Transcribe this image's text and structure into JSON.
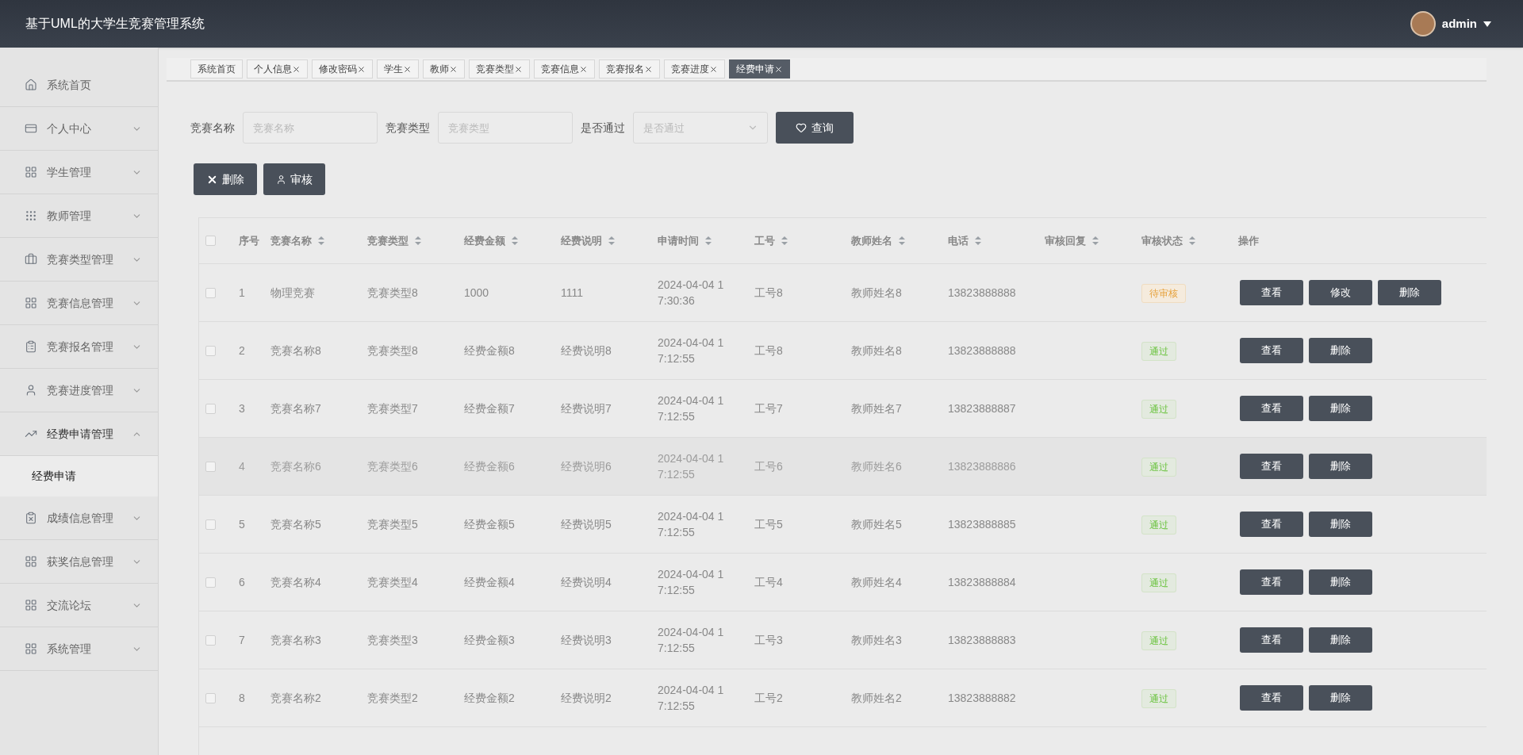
{
  "header": {
    "title": "基于UML的大学生竞赛管理系统",
    "user": "admin"
  },
  "sidebar": {
    "items": [
      {
        "label": "系统首页",
        "kind": "link"
      },
      {
        "label": "个人中心",
        "kind": "menu",
        "expanded": false
      },
      {
        "label": "学生管理",
        "kind": "menu",
        "expanded": false
      },
      {
        "label": "教师管理",
        "kind": "menu",
        "expanded": false
      },
      {
        "label": "竞赛类型管理",
        "kind": "menu",
        "expanded": false
      },
      {
        "label": "竞赛信息管理",
        "kind": "menu",
        "expanded": false
      },
      {
        "label": "竞赛报名管理",
        "kind": "menu",
        "expanded": false
      },
      {
        "label": "竞赛进度管理",
        "kind": "menu",
        "expanded": false
      },
      {
        "label": "经费申请管理",
        "kind": "menu",
        "expanded": true,
        "children": [
          {
            "label": "经费申请",
            "selected": true
          }
        ]
      },
      {
        "label": "成绩信息管理",
        "kind": "menu",
        "expanded": false
      },
      {
        "label": "获奖信息管理",
        "kind": "menu",
        "expanded": false
      },
      {
        "label": "交流论坛",
        "kind": "menu",
        "expanded": false
      },
      {
        "label": "系统管理",
        "kind": "menu",
        "expanded": false
      }
    ]
  },
  "tabs": [
    {
      "label": "系统首页",
      "closable": false,
      "selected": false
    },
    {
      "label": "个人信息",
      "closable": true,
      "selected": false
    },
    {
      "label": "修改密码",
      "closable": true,
      "selected": false
    },
    {
      "label": "学生",
      "closable": true,
      "selected": false
    },
    {
      "label": "教师",
      "closable": true,
      "selected": false
    },
    {
      "label": "竞赛类型",
      "closable": true,
      "selected": false
    },
    {
      "label": "竞赛信息",
      "closable": true,
      "selected": false
    },
    {
      "label": "竞赛报名",
      "closable": true,
      "selected": false
    },
    {
      "label": "竞赛进度",
      "closable": true,
      "selected": false
    },
    {
      "label": "经费申请",
      "closable": true,
      "selected": true
    }
  ],
  "filters": [
    {
      "label": "竞赛名称",
      "placeholder": "竞赛名称",
      "kind": "text"
    },
    {
      "label": "竞赛类型",
      "placeholder": "竞赛类型",
      "kind": "text"
    },
    {
      "label": "是否通过",
      "placeholder": "是否通过",
      "kind": "select"
    }
  ],
  "search_button": "查询",
  "actions": [
    {
      "label": "删除",
      "kind": "delete"
    },
    {
      "label": "审核",
      "kind": "review"
    }
  ],
  "table": {
    "all_checked": false,
    "columns": [
      "序号",
      "竞赛名称",
      "竞赛类型",
      "经费金额",
      "经费说明",
      "申请时间",
      "工号",
      "教师姓名",
      "电话",
      "审核回复",
      "审核状态",
      "操作"
    ],
    "rows": [
      {
        "checked": false,
        "hovered": false,
        "cells": [
          "1",
          "物理竞赛",
          "竞赛类型8",
          "1000",
          "1111",
          "2024-04-04 17:30:36",
          "工号8",
          "教师姓名8",
          "13823888888",
          ""
        ],
        "status": {
          "text": "待审核",
          "kind": "pending"
        },
        "buttons": [
          "查看",
          "修改",
          "删除"
        ]
      },
      {
        "checked": false,
        "hovered": false,
        "cells": [
          "2",
          "竞赛名称8",
          "竞赛类型8",
          "经费金额8",
          "经费说明8",
          "2024-04-04 17:12:55",
          "工号8",
          "教师姓名8",
          "13823888888",
          ""
        ],
        "status": {
          "text": "通过",
          "kind": "passed"
        },
        "buttons": [
          "查看",
          "删除"
        ]
      },
      {
        "checked": false,
        "hovered": false,
        "cells": [
          "3",
          "竞赛名称7",
          "竞赛类型7",
          "经费金额7",
          "经费说明7",
          "2024-04-04 17:12:55",
          "工号7",
          "教师姓名7",
          "13823888887",
          ""
        ],
        "status": {
          "text": "通过",
          "kind": "passed"
        },
        "buttons": [
          "查看",
          "删除"
        ]
      },
      {
        "checked": false,
        "hovered": true,
        "cells": [
          "4",
          "竞赛名称6",
          "竞赛类型6",
          "经费金额6",
          "经费说明6",
          "2024-04-04 17:12:55",
          "工号6",
          "教师姓名6",
          "13823888886",
          ""
        ],
        "status": {
          "text": "通过",
          "kind": "passed"
        },
        "buttons": [
          "查看",
          "删除"
        ]
      },
      {
        "checked": false,
        "hovered": false,
        "cells": [
          "5",
          "竞赛名称5",
          "竞赛类型5",
          "经费金额5",
          "经费说明5",
          "2024-04-04 17:12:55",
          "工号5",
          "教师姓名5",
          "13823888885",
          ""
        ],
        "status": {
          "text": "通过",
          "kind": "passed"
        },
        "buttons": [
          "查看",
          "删除"
        ]
      },
      {
        "checked": false,
        "hovered": false,
        "cells": [
          "6",
          "竞赛名称4",
          "竞赛类型4",
          "经费金额4",
          "经费说明4",
          "2024-04-04 17:12:55",
          "工号4",
          "教师姓名4",
          "13823888884",
          ""
        ],
        "status": {
          "text": "通过",
          "kind": "passed"
        },
        "buttons": [
          "查看",
          "删除"
        ]
      },
      {
        "checked": false,
        "hovered": false,
        "cells": [
          "7",
          "竞赛名称3",
          "竞赛类型3",
          "经费金额3",
          "经费说明3",
          "2024-04-04 17:12:55",
          "工号3",
          "教师姓名3",
          "13823888883",
          ""
        ],
        "status": {
          "text": "通过",
          "kind": "passed"
        },
        "buttons": [
          "查看",
          "删除"
        ]
      },
      {
        "checked": false,
        "hovered": false,
        "cells": [
          "8",
          "竞赛名称2",
          "竞赛类型2",
          "经费金额2",
          "经费说明2",
          "2024-04-04 17:12:55",
          "工号2",
          "教师姓名2",
          "13823888882",
          ""
        ],
        "status": {
          "text": "通过",
          "kind": "passed"
        },
        "buttons": [
          "查看",
          "删除"
        ]
      }
    ]
  }
}
